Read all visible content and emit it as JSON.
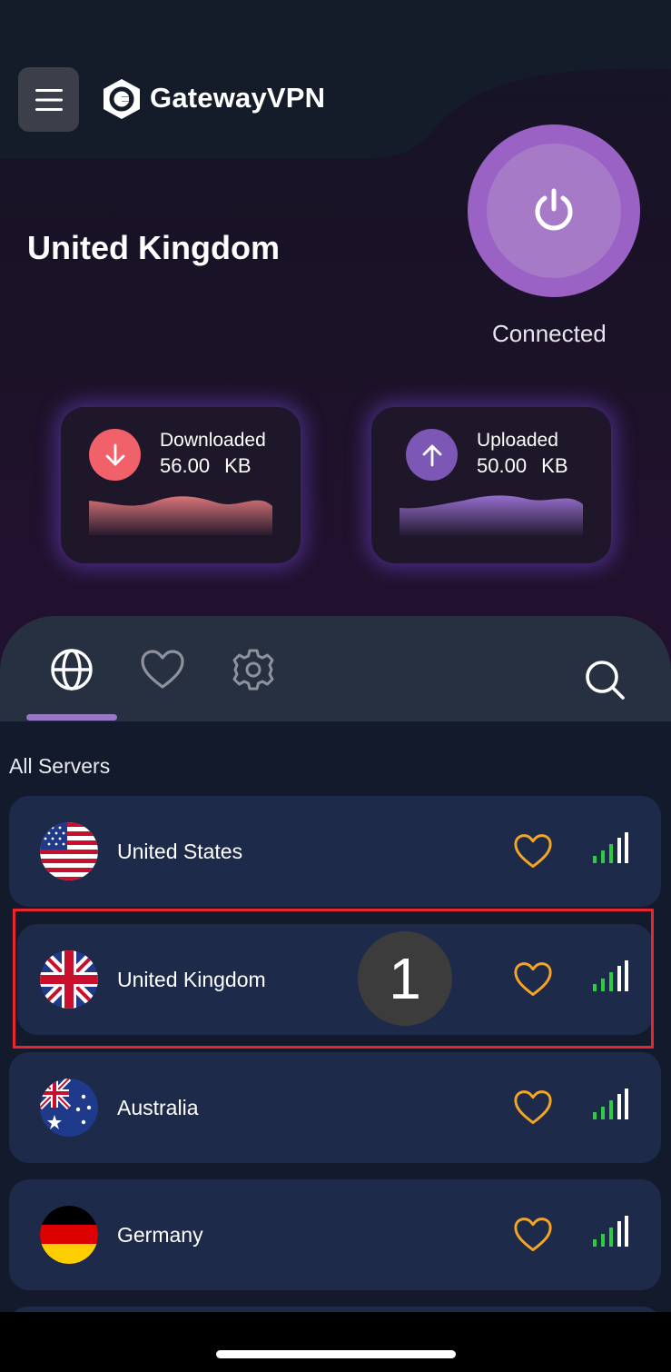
{
  "header": {
    "app_name": "GatewayVPN",
    "menu_icon": "hamburger-icon",
    "logo_icon": "gateway-logo-icon"
  },
  "connection": {
    "country": "United Kingdom",
    "status": "Connected",
    "power_icon": "power-icon"
  },
  "stats": {
    "download": {
      "label": "Downloaded",
      "value": "56.00 KB",
      "icon": "arrow-down-icon",
      "color": "#f0616a"
    },
    "upload": {
      "label": "Uploaded",
      "value": "50.00 KB",
      "icon": "arrow-up-icon",
      "color": "#7c57b5"
    }
  },
  "tabs": [
    {
      "icon": "globe-icon",
      "active": true
    },
    {
      "icon": "heart-icon",
      "active": false
    },
    {
      "icon": "gear-icon",
      "active": false
    }
  ],
  "search_icon": "search-icon",
  "servers": {
    "heading": "All Servers",
    "items": [
      {
        "name": "United States",
        "flag": "us-flag-icon"
      },
      {
        "name": "United Kingdom",
        "flag": "uk-flag-icon",
        "selected": true
      },
      {
        "name": "Australia",
        "flag": "australia-flag-icon"
      },
      {
        "name": "Germany",
        "flag": "germany-flag-icon"
      }
    ]
  },
  "annotation": {
    "step": "1",
    "highlight_color": "#e8262f"
  },
  "colors": {
    "accent": "#9a62c4",
    "favorite": "#f5a524",
    "signal": "#2ecc40"
  }
}
